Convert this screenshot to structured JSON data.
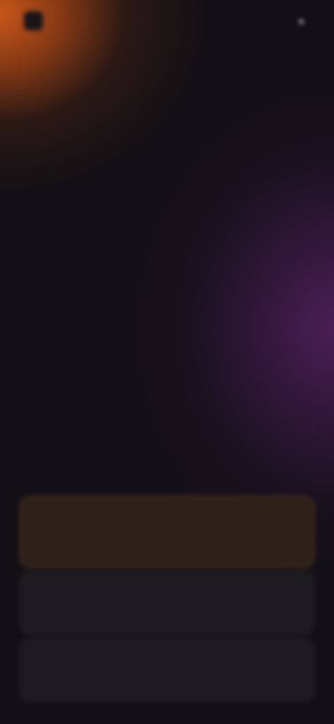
{
  "header": {
    "logo_text": "",
    "action_label": ""
  },
  "breadcrumb": "",
  "headline": "",
  "options": [
    {
      "label": "",
      "selected": true
    },
    {
      "label": "",
      "selected": false
    },
    {
      "label": "",
      "selected": false
    }
  ],
  "colors": {
    "background": "#121015",
    "accent_orange": "#c8561a",
    "accent_purple": "#4a1f56",
    "selected_option": "#2f2119",
    "option": "#1d1b20"
  },
  "icons": [
    "logo-mark-icon",
    "menu-dot-icon"
  ]
}
